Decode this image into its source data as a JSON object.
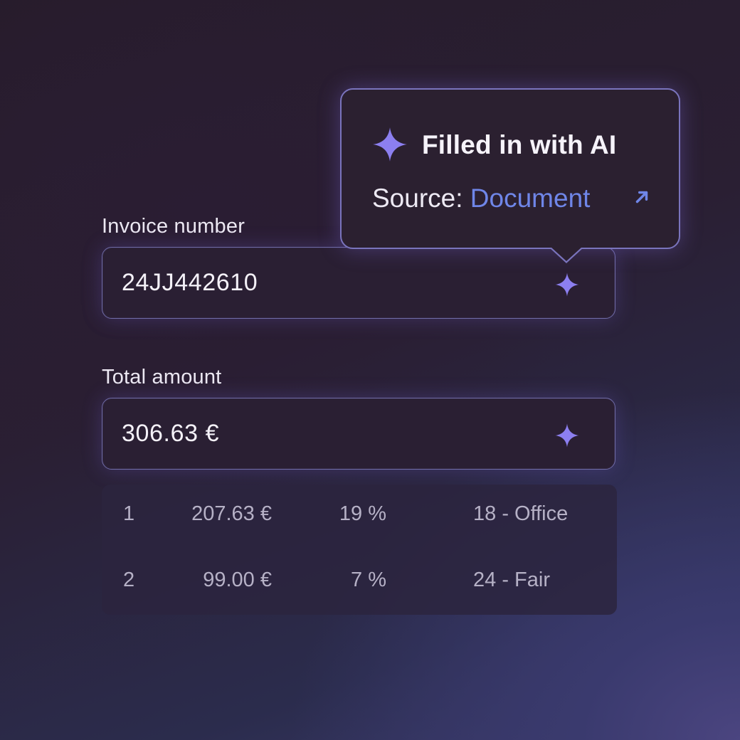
{
  "colors": {
    "accent": "#8c7ff0",
    "link": "#6f86e8",
    "field_border": "#6f6ba6"
  },
  "invoice_field": {
    "label": "Invoice number",
    "value": "24JJ442610",
    "icon": "sparkle-icon"
  },
  "total_field": {
    "label": "Total amount",
    "value": "306.63 €",
    "icon": "sparkle-icon"
  },
  "breakdown": {
    "rows": [
      {
        "index": "1",
        "amount": "207.63 €",
        "vat": "19 %",
        "account": "18 - Office"
      },
      {
        "index": "2",
        "amount": "99.00 €",
        "vat": "7 %",
        "account": "24 - Fair"
      }
    ]
  },
  "tooltip": {
    "icon": "sparkle-icon",
    "title": "Filled in with AI",
    "source_label": "Source:",
    "source_link": "Document",
    "link_icon": "arrow-up-right-icon"
  }
}
